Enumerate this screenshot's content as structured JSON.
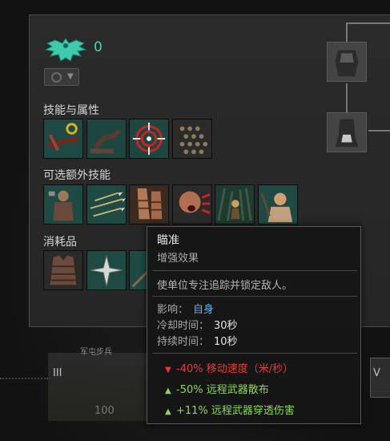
{
  "crest": {
    "count": "0",
    "icon": "eagle-crest-icon",
    "color": "#3fd5b4"
  },
  "rank": {
    "icon": "rank-coin-icon"
  },
  "sections": {
    "skills_title": "技能与属性",
    "optional_title": "可选额外技能",
    "consumables_title": "消耗品"
  },
  "skills": [
    {
      "icon": "crossbow-reload-icon"
    },
    {
      "icon": "running-soldier-icon"
    },
    {
      "icon": "target-reticle-icon"
    },
    {
      "icon": "ammo-bolts-icon"
    }
  ],
  "optional_skills": [
    {
      "icon": "warrior-pose-icon"
    },
    {
      "icon": "volley-arrows-icon"
    },
    {
      "icon": "sandal-feet-icon"
    },
    {
      "icon": "battle-cry-icon"
    },
    {
      "icon": "forest-ambush-icon"
    },
    {
      "icon": "bald-monk-icon"
    }
  ],
  "consumables": [
    {
      "icon": "armor-vest-icon"
    },
    {
      "icon": "caltrops-icon"
    },
    {
      "icon": "spear-icon"
    }
  ],
  "bottom": {
    "card_label": "军屯步兵",
    "roman_left": "III",
    "cost": "100",
    "roman_right": "V"
  },
  "tooltip": {
    "title": "瞄准",
    "subtitle": "增强效果",
    "description": "使单位专注追踪并锁定敌人。",
    "affects_label": "影响：",
    "affects_value": "自身",
    "cooldown_label": "冷却时间：",
    "cooldown_value": "30秒",
    "duration_label": "持续时间：",
    "duration_value": "10秒",
    "modifiers": [
      {
        "sign": "down",
        "text": "-40% 移动速度（米/秒）",
        "color": "#e43a3a"
      },
      {
        "sign": "up",
        "text": "-50% 远程武器散布",
        "color": "#8fd55a"
      },
      {
        "sign": "up",
        "text": "+11% 远程武器穿透伤害",
        "color": "#8fd55a"
      }
    ]
  }
}
